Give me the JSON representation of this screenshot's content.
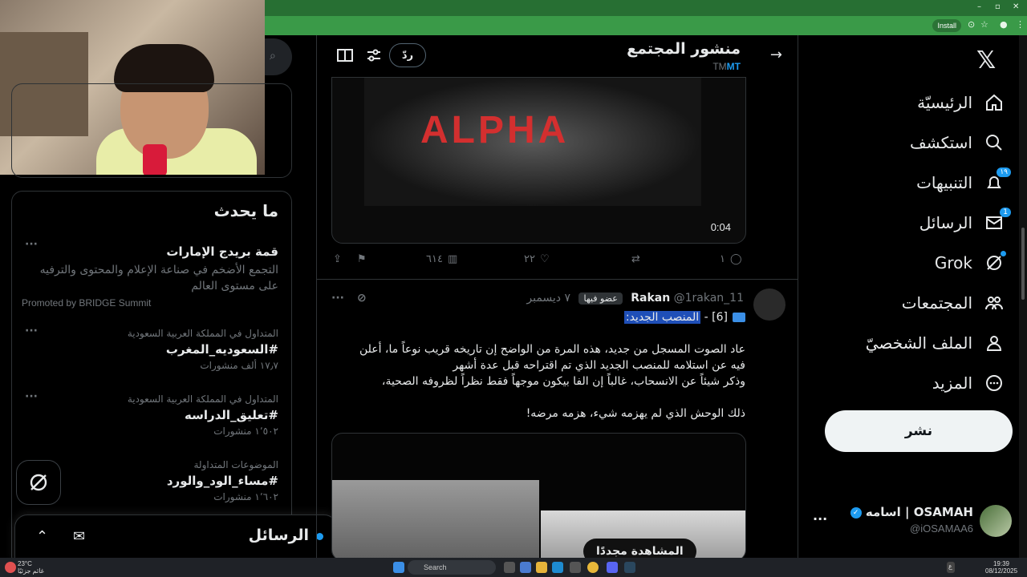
{
  "browser": {
    "install_label": "Install"
  },
  "header": {
    "title": "منشور المجتمع",
    "community_tag": "MT",
    "community_tag_prefix": "TM",
    "reply_label": "ردّ"
  },
  "nav": {
    "items": [
      {
        "label": "الرئيسيّة",
        "icon": "home-icon"
      },
      {
        "label": "استكشف",
        "icon": "search-icon"
      },
      {
        "label": "التنبيهات",
        "icon": "bell-icon",
        "badge": "١٩"
      },
      {
        "label": "الرسائل",
        "icon": "mail-icon",
        "badge": "1"
      },
      {
        "label": "Grok",
        "icon": "grok-icon"
      },
      {
        "label": "المجتمعات",
        "icon": "communities-icon"
      },
      {
        "label": "الملف الشخصيّ",
        "icon": "profile-icon"
      },
      {
        "label": "المزيد",
        "icon": "more-icon"
      }
    ],
    "post_button": "نشر",
    "account": {
      "name": "اسامه | OSAMAH",
      "handle": "@iOSAMAA6"
    }
  },
  "video1": {
    "overlay_text": "ALPHA",
    "duration": "0:04"
  },
  "actions1": {
    "replies": "١",
    "retweets": "",
    "likes": "٢٢",
    "views": "٦١٤"
  },
  "tweet": {
    "name": "Rakan",
    "handle": "@1rakan_11",
    "member_label": "عضو فيها",
    "date": "٧ ديسمبر",
    "tag_prefix": "[6] -",
    "tag_selected": "المنصب الجديد:",
    "body_lines": [
      "عاد الصوت المسجل من جديد، هذه المرة من الواضح إن تاريخه قريب نوعاً ما، أعلن",
      "فيه عن استلامه للمنصب الجديد الذي تم اقتراحه قبل عدة أشهر",
      "وذكر شيئاً عن الانسحاب، غالباً إن الفا بيكون موجهاً فقط نظراً لظروفه الصحية،",
      "",
      "ذلك الوحش الذي لم يهزمه شيء، هزمه مرضه!"
    ],
    "rewatch_label": "المشاهدة مجددًا"
  },
  "sidebar": {
    "trends_title": "ما يحدث",
    "trends": [
      {
        "context": "",
        "title": "قمة بريدج الإمارات",
        "desc": "التجمع الأضخم في صناعة الإعلام والمحتوى والترفيه على مستوى العالم",
        "promo": "Promoted by BRIDGE Summit",
        "meta": ""
      },
      {
        "context": "المتداول في المملكة العربية السعودية",
        "title": "#السعوديه_المغرب",
        "desc": "",
        "promo": "",
        "meta": "١٧٫٧ ألف منشورات"
      },
      {
        "context": "المتداول في المملكة العربية السعودية",
        "title": "#تعليق_الدراسه",
        "desc": "",
        "promo": "",
        "meta": "١٬٥٠٢ منشورات"
      },
      {
        "context": "الموضوعات المتداولة",
        "title": "#مساء_الود_والورد",
        "desc": "",
        "promo": "",
        "meta": "١٬٦٠٢ منشورات"
      }
    ],
    "messages_drawer_title": "الرسائل"
  },
  "taskbar": {
    "search_placeholder": "Search",
    "weather_temp": "23°C",
    "weather_desc": "غائم جزئيًا",
    "clock_time": "19:39",
    "clock_date": "08/12/2025",
    "lang": "ع"
  },
  "colors": {
    "accent": "#1d9bf0",
    "background": "#000000",
    "browser_bar": "#2e8b3e",
    "alpha_red": "#d32f2f"
  }
}
